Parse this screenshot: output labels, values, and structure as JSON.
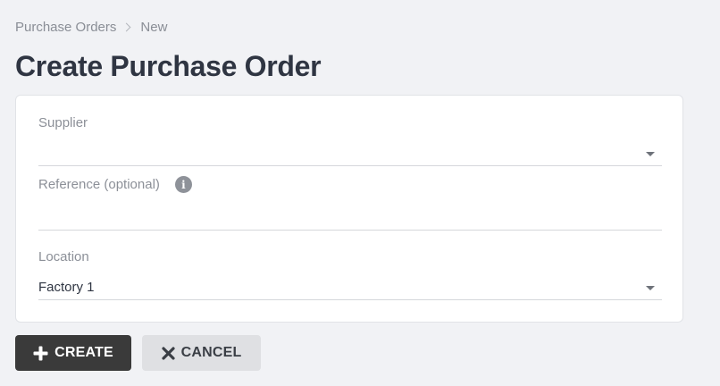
{
  "breadcrumb": {
    "items": [
      "Purchase Orders",
      "New"
    ]
  },
  "page": {
    "title": "Create Purchase Order"
  },
  "form": {
    "supplier": {
      "label": "Supplier",
      "value": ""
    },
    "reference": {
      "label": "Reference (optional)",
      "value": ""
    },
    "location": {
      "label": "Location",
      "value": "Factory 1"
    }
  },
  "actions": {
    "create_label": "CREATE",
    "cancel_label": "CANCEL"
  },
  "colors": {
    "background": "#f1f2f5",
    "primary_button": "#3a3a3a",
    "secondary_button": "#dfe0e3"
  },
  "icons": {
    "separator": "chevron-right-icon",
    "info": "info-icon",
    "dropdown": "caret-down-icon",
    "create": "plus-icon",
    "cancel": "close-icon"
  }
}
